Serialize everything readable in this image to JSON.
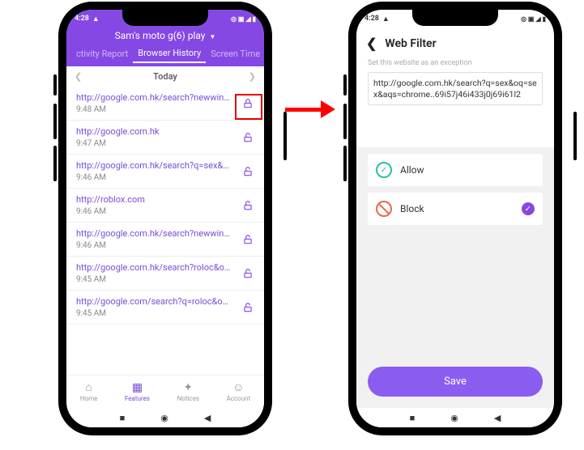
{
  "status": {
    "time": "4:28",
    "icons_right": "◎ ▣ ◢ ▮"
  },
  "left": {
    "device_name": "Sam's moto g(6) play",
    "tabs": {
      "activity": "ctivity Report",
      "browser": "Browser History",
      "screen": "Screen Time"
    },
    "date": {
      "label": "Today"
    },
    "items": [
      {
        "url": "http://google.com.hk/search?newwindow...",
        "time": "9:48 AM"
      },
      {
        "url": "http://google.com.hk",
        "time": "9:47 AM"
      },
      {
        "url": "http://google.com.hk/search?q=sex&oq=s...",
        "time": "9:46 AM"
      },
      {
        "url": "http://roblox.com",
        "time": "9:46 AM"
      },
      {
        "url": "http://google.com.hk/search?newwindow...",
        "time": "9:46 AM"
      },
      {
        "url": "http://google.com.hk/search?roloc&oq...",
        "time": "9:45 AM"
      },
      {
        "url": "http://google.com/search?q=roloc&oq=rol...",
        "time": "9:45 AM"
      }
    ],
    "bottom": {
      "home": "Home",
      "features": "Features",
      "notices": "Notices",
      "account": "Account"
    }
  },
  "right": {
    "title": "Web Filter",
    "subtitle": "Set this website as an exception",
    "url": "http://google.com.hk/search?q=sex&oq=sex&aqs=chrome..69i57j46i433j0j69i61l2",
    "allow": "Allow",
    "block": "Block",
    "save": "Save"
  }
}
